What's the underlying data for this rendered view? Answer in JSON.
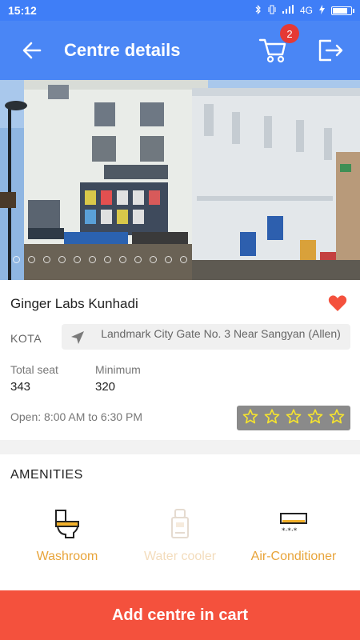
{
  "status_bar": {
    "time": "15:12",
    "network": "4G"
  },
  "app_bar": {
    "title": "Centre details",
    "cart_count": "2"
  },
  "centre": {
    "name": "Ginger Labs Kunhadi",
    "city": "KOTA",
    "address": "Landmark City Gate No. 3 Near Sangyan (Allen)",
    "total_seat_label": "Total seat",
    "total_seat": "343",
    "minimum_label": "Minimum",
    "minimum": "320",
    "open_hours": "Open: 8:00 AM to 6:30 PM",
    "rating_stars": 5,
    "rating_filled": 0
  },
  "amenities": {
    "title": "AMENITIES",
    "items": [
      {
        "label": "Washroom",
        "icon": "toilet-icon",
        "available": true
      },
      {
        "label": "Water cooler",
        "icon": "water-cooler-icon",
        "available": false
      },
      {
        "label": "Air-Conditioner",
        "icon": "air-conditioner-icon",
        "available": true
      }
    ]
  },
  "cta": {
    "label": "Add centre in cart"
  },
  "colors": {
    "primary": "#4a86f5",
    "accent": "#f4513d",
    "amenity": "#e8a43a",
    "heart": "#f4513d"
  }
}
